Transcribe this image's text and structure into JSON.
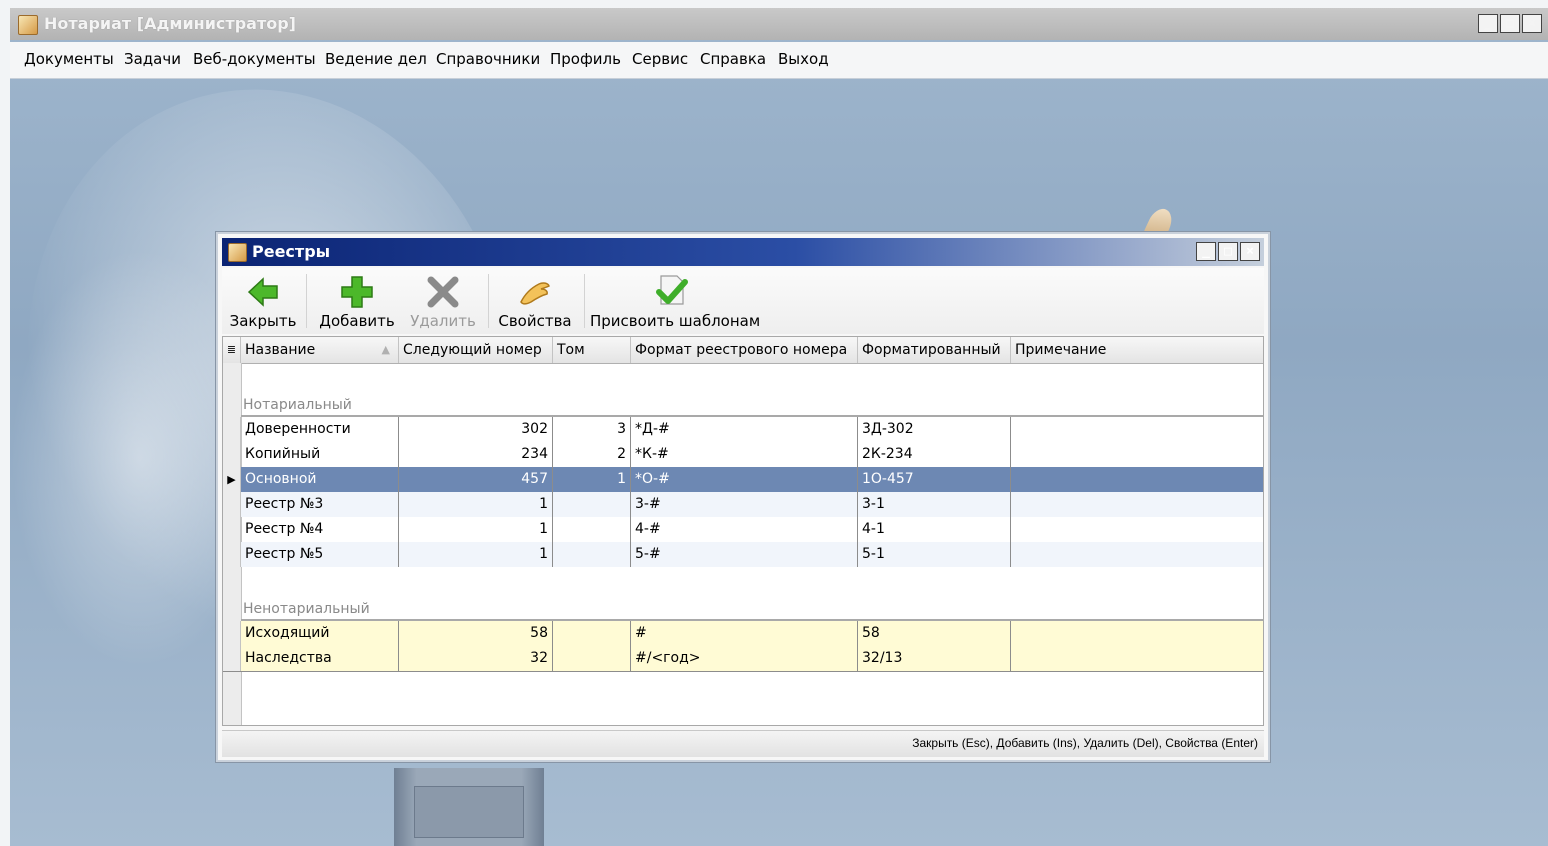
{
  "app": {
    "title": "Нотариат [Администратор]",
    "win_min": "_",
    "win_max": "□",
    "win_close": "×"
  },
  "menu": [
    "Документы",
    "Задачи",
    "Веб-документы",
    "Ведение дел",
    "Справочники",
    "Профиль",
    "Сервис",
    "Справка",
    "Выход"
  ],
  "dialog": {
    "title": "Реестры",
    "toolbar": {
      "close": "Закрыть",
      "add": "Добавить",
      "delete": "Удалить",
      "properties": "Свойства",
      "assign": "Присвоить шаблонам"
    },
    "columns": [
      "Название",
      "Следующий номер",
      "Том",
      "Формат реестрового номера",
      "Форматированный",
      "Примечание"
    ],
    "groups": [
      {
        "label": "Нотариальный",
        "rows": [
          [
            "Доверенности",
            "302",
            "3",
            "*Д-#",
            "3Д-302",
            ""
          ],
          [
            "Копийный",
            "234",
            "2",
            "*К-#",
            "2К-234",
            ""
          ],
          [
            "Основной",
            "457",
            "1",
            "*О-#",
            "1О-457",
            ""
          ],
          [
            "Реестр №3",
            "1",
            "",
            "3-#",
            "3-1",
            ""
          ],
          [
            "Реестр №4",
            "1",
            "",
            "4-#",
            "4-1",
            ""
          ],
          [
            "Реестр №5",
            "1",
            "",
            "5-#",
            "5-1",
            ""
          ]
        ]
      },
      {
        "label": "Ненотариальный",
        "rows": [
          [
            "Исходящий",
            "58",
            "",
            "#",
            "58",
            ""
          ],
          [
            "Наследства",
            "32",
            "",
            "#/<год>",
            "32/13",
            ""
          ]
        ]
      }
    ],
    "status": "Закрыть (Esc), Добавить (Ins), Удалить (Del), Свойства (Enter)"
  },
  "colors": {
    "selected_row": "#6d88b3",
    "nonnotarial_row": "#fffbd5",
    "dialog_title": "#0b2474"
  }
}
